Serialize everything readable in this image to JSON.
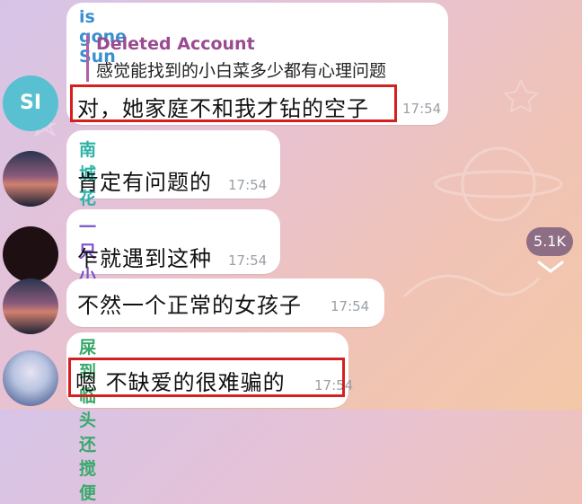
{
  "messages": [
    {
      "sender": "is gone Sun",
      "sender_color": "#3b8fd0",
      "reply": {
        "name": "Deleted Account",
        "text": "感觉能找到的小白菜多少都有心理问题"
      },
      "avatar_text": "SI",
      "avatar_color": "#58c0d0",
      "text": "对，她家庭不和我才钻的空子",
      "time": "17:54"
    },
    {
      "sender": "南城花已开",
      "sender_color": "#2db3a6",
      "text": "肯定有问题的",
      "time": "17:54"
    },
    {
      "sender": "一只小神",
      "sender_color": "#7a55c8",
      "text": "乍就遇到这种",
      "time": "17:54"
    },
    {
      "text": "不然一个正常的女孩子",
      "time": "17:54"
    },
    {
      "sender": "屎到临头还搅便",
      "sender_color": "#39a96b",
      "text": "嗯 不缺爱的很难骗的",
      "time": "17:54"
    }
  ],
  "badge": {
    "views": "5.1K"
  }
}
